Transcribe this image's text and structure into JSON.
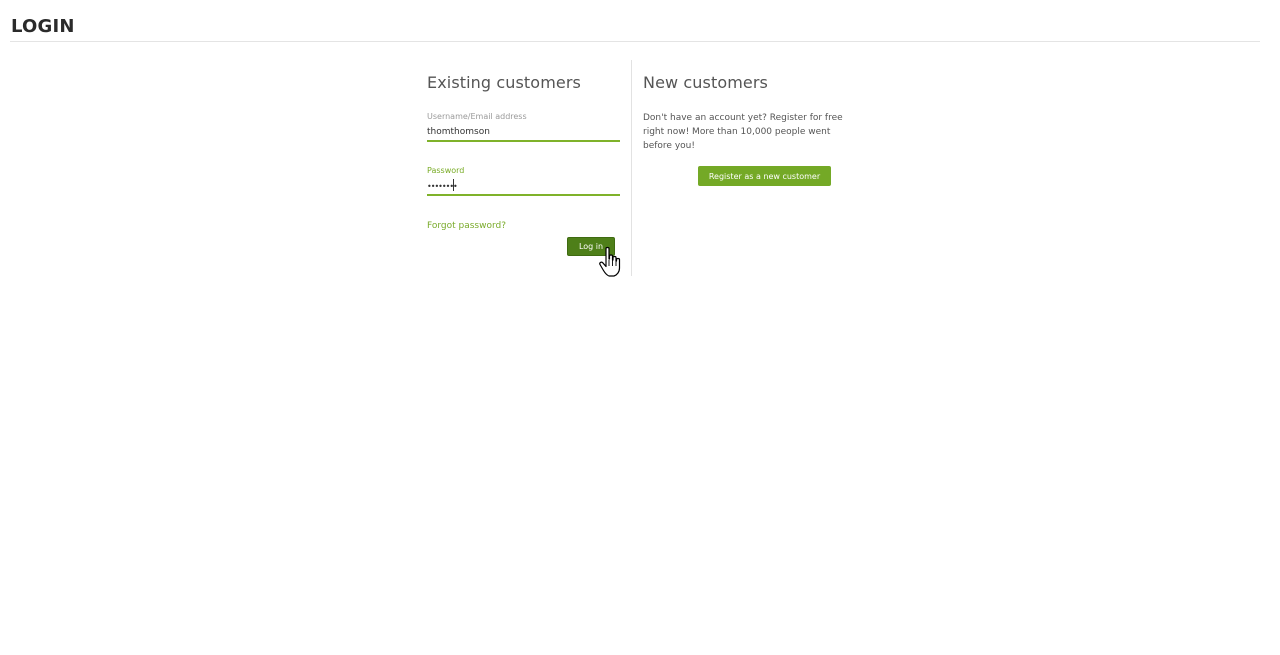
{
  "page": {
    "title": "LOGIN"
  },
  "existing": {
    "title": "Existing customers",
    "username": {
      "label": "Username/Email address",
      "value": "thomthomson"
    },
    "password": {
      "label": "Password",
      "value": "••••••••"
    },
    "forgot_label": "Forgot password?",
    "login_label": "Log in"
  },
  "new_customers": {
    "title": "New customers",
    "text": "Don't have an account yet? Register for free right now! More than 10,000 people went before you!",
    "register_label": "Register as a new customer"
  },
  "colors": {
    "accent": "#7fb22a",
    "login_button": "#4e7f19",
    "register_button": "#74a926",
    "link": "#7aab2b"
  },
  "icons": {
    "cursor": "hand-pointer-icon"
  }
}
